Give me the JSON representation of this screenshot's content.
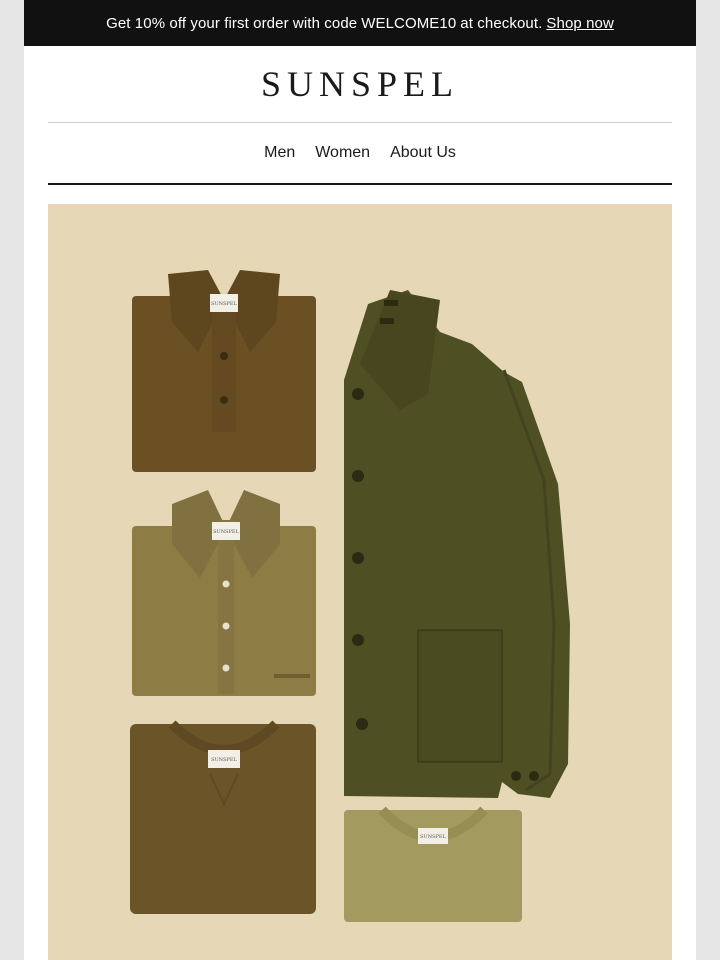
{
  "promo": {
    "text_before": "Get 10% off your first order with code",
    "code": "WELCOME10",
    "text_after": "at checkout.",
    "link": "Shop now"
  },
  "brand": {
    "logo_text": "SUNSPEL"
  },
  "nav": {
    "items": [
      {
        "label": "Men"
      },
      {
        "label": "Women"
      },
      {
        "label": "About Us"
      }
    ]
  },
  "hero": {
    "image_alt": "Flat lay of folded olive and khaki clothing",
    "label_text": "SUNSPEL",
    "colors": {
      "background": "#e6d7b6",
      "polo": "#6b5024",
      "oxford_shirt": "#8e7c45",
      "sweatshirt": "#6c5429",
      "overshirt": "#4f4f24",
      "tshirt": "#a29a5e"
    }
  }
}
